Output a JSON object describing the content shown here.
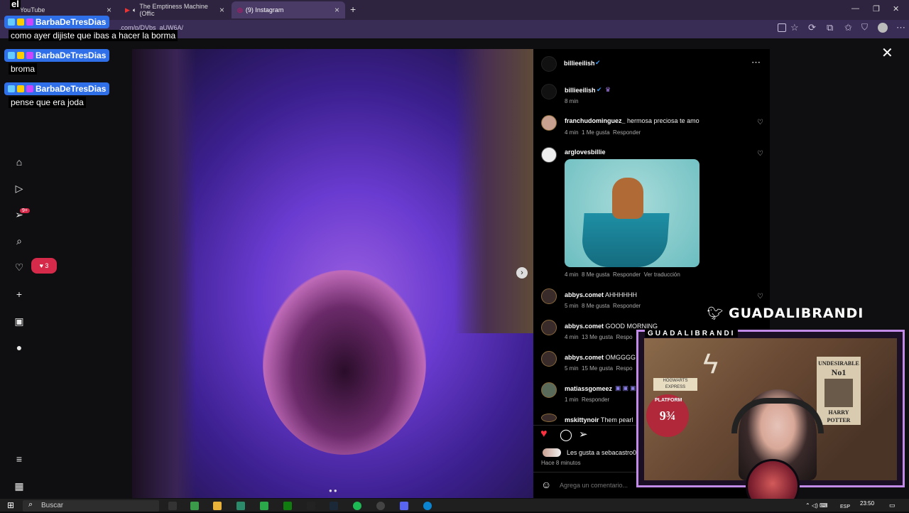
{
  "browser": {
    "tabs": [
      {
        "label": "YouTube",
        "active": false
      },
      {
        "label": "The Emptiness Machine (Offic",
        "active": false
      },
      {
        "label": "(9) Instagram",
        "active": true
      }
    ],
    "url": ".com/p/DVbs_aUW6A/"
  },
  "instagram": {
    "post_author": "billieeilish",
    "caption_author": "billieeilish",
    "caption_time": "8 min",
    "comments": [
      {
        "user": "franchudominguez_",
        "text": "hermosa preciosa te amo",
        "time": "4 min",
        "likes": "1 Me gusta",
        "reply": "Responder"
      },
      {
        "user": "arglovesbillie",
        "text": "",
        "time": "4 min",
        "likes": "8 Me gusta",
        "reply": "Responder",
        "translate": "Ver traducción"
      },
      {
        "user": "abbys.comet",
        "text": "AHHHHHH",
        "time": "5 min",
        "likes": "8 Me gusta",
        "reply": "Responder"
      },
      {
        "user": "abbys.comet",
        "text": "GOOD MORNING",
        "time": "4 min",
        "likes": "13 Me gusta",
        "reply": "Respo"
      },
      {
        "user": "abbys.comet",
        "text": "OMGGGG",
        "time": "5 min",
        "likes": "15 Me gusta",
        "reply": "Respo"
      },
      {
        "user": "matiassgomeez",
        "text": "",
        "time": "1 min",
        "likes": "",
        "reply": "Responder"
      },
      {
        "user": "mskittynoir",
        "text": "Them pearl",
        "time": "",
        "likes": "",
        "reply": ""
      }
    ],
    "liked_by": "Les gusta a sebacastro0",
    "posted_ago": "Hace 8 minutos",
    "comment_placeholder": "Agrega un comentario...",
    "notifications_count": "3",
    "messages_badge": "9+"
  },
  "chat": [
    {
      "user": "BarbaDeTresDias",
      "message": "como ayer dijiste que ibas a hacer la borma"
    },
    {
      "user": "BarbaDeTresDias",
      "message": "broma"
    },
    {
      "user": "BarbaDeTresDias",
      "message": "pense que era joda"
    }
  ],
  "chat_top_fragment": "el",
  "stream": {
    "twitter_handle": "GUADALIBRANDI",
    "cam_label": "GUADALIBRANDI",
    "poster_title": "UNDESIRABLE",
    "poster_no": "No1",
    "poster_name": "HARRY POTTER",
    "platform": "9¾",
    "platform_sign": "PLATFORM",
    "hogwarts": "HOGWARTS EXPRESS"
  },
  "taskbar": {
    "search_placeholder": "Buscar",
    "time": "23:50",
    "lang": "ESP"
  }
}
